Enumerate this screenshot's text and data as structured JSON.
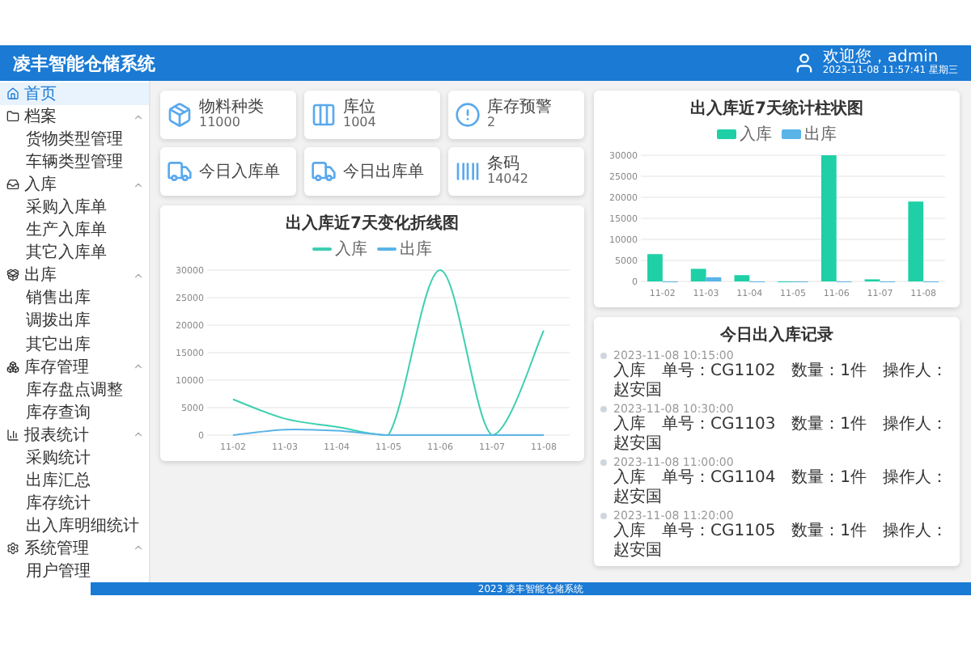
{
  "header": {
    "title": "凌丰智能仓储系统",
    "greeting": "欢迎您，admin",
    "datetime": "2023-11-08 11:57:41 星期三"
  },
  "sidebar": {
    "items": [
      {
        "kind": "home",
        "label": "首页",
        "selected": true
      },
      {
        "kind": "folder",
        "label": "档案",
        "selected": false,
        "expanded": true,
        "children": [
          {
            "label": "货物类型管理",
            "selected": false
          },
          {
            "label": "车辆类型管理",
            "selected": false
          }
        ]
      },
      {
        "kind": "inbox",
        "label": "入库",
        "selected": false,
        "expanded": true,
        "children": [
          {
            "label": "采购入库单",
            "selected": false
          },
          {
            "label": "生产入库单",
            "selected": false
          },
          {
            "label": "其它入库单",
            "selected": false
          }
        ]
      },
      {
        "kind": "outbox",
        "label": "出库",
        "selected": false,
        "expanded": true,
        "children": [
          {
            "label": "销售出库",
            "selected": false
          },
          {
            "label": "调拨出库",
            "selected": false
          },
          {
            "label": "其它出库",
            "selected": false
          }
        ]
      },
      {
        "kind": "stock",
        "label": "库存管理",
        "selected": false,
        "expanded": true,
        "children": [
          {
            "label": "库存盘点调整",
            "selected": false
          },
          {
            "label": "库存查询",
            "selected": false
          }
        ]
      },
      {
        "kind": "chart",
        "label": "报表统计",
        "selected": false,
        "expanded": true,
        "children": [
          {
            "label": "采购统计",
            "selected": false
          },
          {
            "label": "出库汇总",
            "selected": false
          },
          {
            "label": "库存统计",
            "selected": false
          },
          {
            "label": "出入库明细统计",
            "selected": false
          }
        ]
      },
      {
        "kind": "settings",
        "label": "系统管理",
        "selected": false,
        "expanded": true,
        "children": [
          {
            "label": "用户管理",
            "selected": false
          }
        ]
      }
    ]
  },
  "stat_cards": [
    {
      "kind": "box",
      "label": "物料种类",
      "value": "11000"
    },
    {
      "kind": "shelf",
      "label": "库位",
      "value": "1004"
    },
    {
      "kind": "alert",
      "label": "库存预警",
      "value": "2"
    },
    {
      "kind": "truck-in",
      "label": "今日入库单"
    },
    {
      "kind": "truck-out",
      "label": "今日出库单"
    },
    {
      "kind": "barcode",
      "label": "条码",
      "value": "14042"
    }
  ],
  "line_chart": {
    "chart_data": {
      "type": "line",
      "title": "出入库近7天变化折线图",
      "categories": [
        "11-02",
        "11-03",
        "11-04",
        "11-05",
        "11-06",
        "11-07",
        "11-08"
      ],
      "series": [
        {
          "name": "入库",
          "color": "#3ccfb0",
          "values": [
            6500,
            3000,
            1500,
            0,
            30000,
            0,
            19000
          ]
        },
        {
          "name": "出库",
          "color": "#5ab4e8",
          "values": [
            0,
            1000,
            800,
            0,
            0,
            0,
            0
          ]
        }
      ],
      "grid": true,
      "ylim": [
        0,
        30000
      ],
      "yticks": [
        0,
        5000,
        10000,
        15000,
        20000,
        25000,
        30000
      ]
    }
  },
  "bar_chart": {
    "chart_data": {
      "type": "bar",
      "title": "出入库近7天统计柱状图",
      "categories": [
        "11-02",
        "11-03",
        "11-04",
        "11-05",
        "11-06",
        "11-07",
        "11-08"
      ],
      "series": [
        {
          "name": "入库",
          "color": "#1fd0a7",
          "values": [
            6500,
            3000,
            1500,
            0,
            30000,
            500,
            19000
          ]
        },
        {
          "name": "出库",
          "color": "#5ab4e8",
          "values": [
            0,
            1000,
            0,
            0,
            0,
            0,
            0
          ]
        }
      ],
      "grid": true,
      "ylim": [
        0,
        30000
      ],
      "yticks": [
        0,
        5000,
        10000,
        15000,
        20000,
        25000,
        30000
      ]
    }
  },
  "records": {
    "title": "今日出入库记录",
    "items": [
      {
        "time": "2023-11-08 10:15:00",
        "text": "入库　单号：CG1102　数量：1件　操作人：赵安国"
      },
      {
        "time": "2023-11-08 10:30:00",
        "text": "入库　单号：CG1103　数量：1件　操作人：赵安国"
      },
      {
        "time": "2023-11-08 11:00:00",
        "text": "入库　单号：CG1104　数量：1件　操作人：赵安国"
      },
      {
        "time": "2023-11-08 11:20:00",
        "text": "入库　单号：CG1105　数量：1件　操作人：赵安国"
      }
    ]
  },
  "footer": "2023 凌丰智能仓储系统"
}
